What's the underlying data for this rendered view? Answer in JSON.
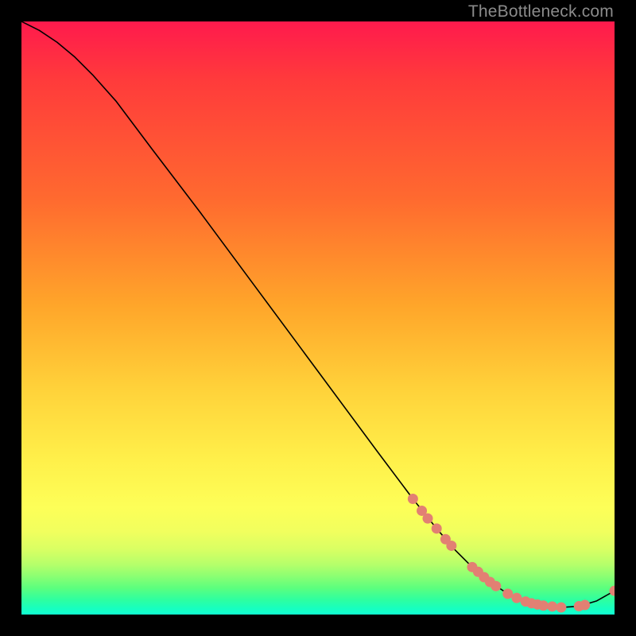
{
  "watermark": "TheBottleneck.com",
  "chart_data": {
    "type": "line",
    "title": "",
    "xlabel": "",
    "ylabel": "",
    "xlim": [
      0,
      100
    ],
    "ylim": [
      0,
      100
    ],
    "grid": false,
    "background": "vertical-gradient red→green",
    "series": [
      {
        "name": "bottleneck-curve",
        "x": [
          0,
          3,
          6,
          9,
          12,
          16,
          22,
          30,
          40,
          50,
          60,
          66,
          70,
          73,
          76,
          79,
          82,
          85,
          88,
          91,
          94,
          97,
          100
        ],
        "y": [
          100,
          98.5,
          96.5,
          94,
          91,
          86.5,
          78.5,
          68,
          54.5,
          41,
          27.5,
          19.5,
          14.5,
          11,
          8,
          5.5,
          3.5,
          2.2,
          1.5,
          1.2,
          1.4,
          2.3,
          4
        ]
      }
    ],
    "markers": {
      "name": "highlighted-points",
      "color": "#e28073",
      "points": [
        {
          "x": 66,
          "y": 19.5
        },
        {
          "x": 67.5,
          "y": 17.5
        },
        {
          "x": 68.5,
          "y": 16.2
        },
        {
          "x": 70,
          "y": 14.5
        },
        {
          "x": 71.5,
          "y": 12.7
        },
        {
          "x": 72.5,
          "y": 11.6
        },
        {
          "x": 76,
          "y": 8
        },
        {
          "x": 77,
          "y": 7.2
        },
        {
          "x": 78,
          "y": 6.3
        },
        {
          "x": 79,
          "y": 5.5
        },
        {
          "x": 80,
          "y": 4.8
        },
        {
          "x": 82,
          "y": 3.5
        },
        {
          "x": 83.5,
          "y": 2.8
        },
        {
          "x": 85,
          "y": 2.2
        },
        {
          "x": 86,
          "y": 1.9
        },
        {
          "x": 87,
          "y": 1.7
        },
        {
          "x": 88,
          "y": 1.5
        },
        {
          "x": 89.5,
          "y": 1.35
        },
        {
          "x": 91,
          "y": 1.2
        },
        {
          "x": 94,
          "y": 1.4
        },
        {
          "x": 95,
          "y": 1.6
        },
        {
          "x": 100,
          "y": 4
        }
      ]
    }
  }
}
